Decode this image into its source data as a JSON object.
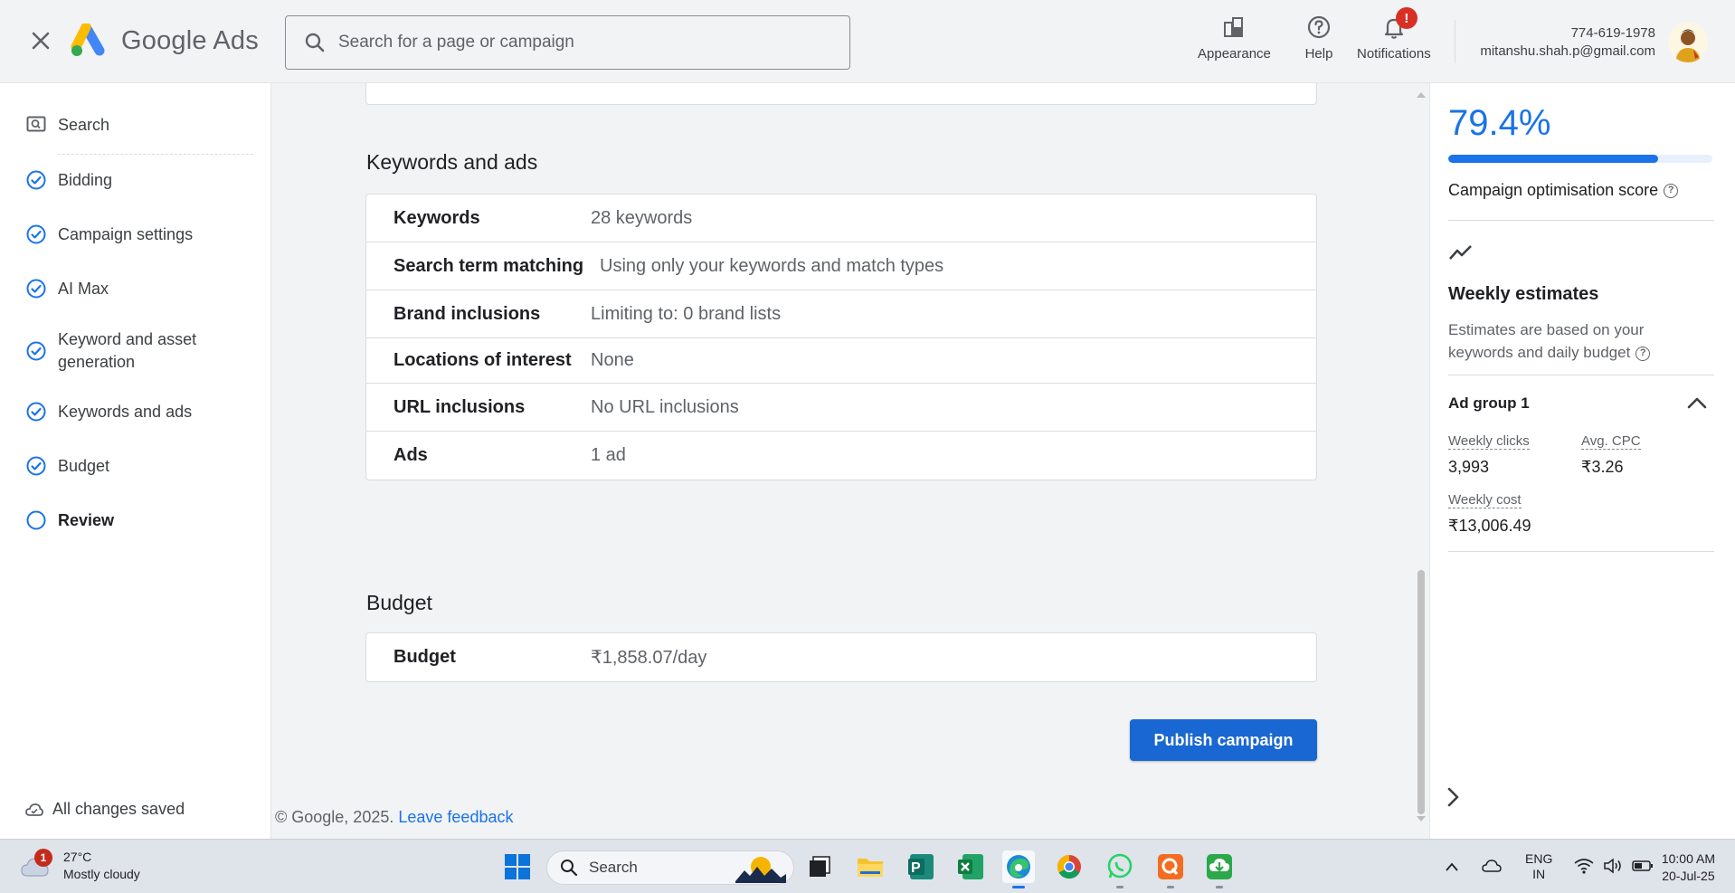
{
  "header": {
    "brand_google": "Google",
    "brand_ads": "Ads",
    "search_placeholder": "Search for a page or campaign",
    "tools": [
      {
        "label": "Appearance",
        "icon": "appearance-icon"
      },
      {
        "label": "Help",
        "icon": "help-icon"
      },
      {
        "label": "Notifications",
        "icon": "bell-icon",
        "badge": "!"
      }
    ],
    "account_phone": "774-619-1978",
    "account_email": "mitanshu.shah.p@gmail.com"
  },
  "sidebar": {
    "items": [
      {
        "label": "Search",
        "icon": "search-campaign-icon",
        "state": "header"
      },
      {
        "label": "Bidding",
        "icon": "check-circle-icon",
        "state": "done"
      },
      {
        "label": "Campaign settings",
        "icon": "check-circle-icon",
        "state": "done"
      },
      {
        "label": "AI Max",
        "icon": "check-circle-icon",
        "state": "done"
      },
      {
        "label": "Keyword and asset generation",
        "icon": "check-circle-icon",
        "state": "done"
      },
      {
        "label": "Keywords and ads",
        "icon": "check-circle-icon",
        "state": "done"
      },
      {
        "label": "Budget",
        "icon": "check-circle-icon",
        "state": "done"
      },
      {
        "label": "Review",
        "icon": "circle-icon",
        "state": "active"
      }
    ],
    "saved_text": "All changes saved"
  },
  "main": {
    "keywords_section": {
      "title": "Keywords and ads",
      "rows": [
        {
          "label": "Keywords",
          "value": "28 keywords"
        },
        {
          "label": "Search term matching",
          "value": "Using only your keywords and match types"
        },
        {
          "label": "Brand inclusions",
          "value": "Limiting to: 0 brand lists"
        },
        {
          "label": "Locations of interest",
          "value": "None"
        },
        {
          "label": "URL inclusions",
          "value": "No URL inclusions"
        },
        {
          "label": "Ads",
          "value": "1 ad"
        }
      ]
    },
    "budget_section": {
      "title": "Budget",
      "rows": [
        {
          "label": "Budget",
          "value": "₹1,858.07/day"
        }
      ]
    },
    "publish_label": "Publish campaign",
    "footer_copyright": "© Google, 2025.",
    "footer_link": "Leave feedback"
  },
  "right_panel": {
    "score": "79.4%",
    "score_fraction": 0.794,
    "score_label": "Campaign optimisation score",
    "weekly_title": "Weekly estimates",
    "weekly_desc": "Estimates are based on your keywords and daily budget",
    "ad_group": "Ad group 1",
    "metrics": {
      "weekly_clicks_label": "Weekly clicks",
      "weekly_clicks": "3,993",
      "avg_cpc_label": "Avg. CPC",
      "avg_cpc": "₹3.26",
      "weekly_cost_label": "Weekly cost",
      "weekly_cost": "₹13,006.49"
    }
  },
  "taskbar": {
    "weather_badge": "1",
    "temperature": "27°C",
    "condition": "Mostly cloudy",
    "search_label": "Search",
    "language_top": "ENG",
    "language_bottom": "IN",
    "time": "10:00 AM",
    "date": "20-Jul-25"
  },
  "colors": {
    "accent": "#1a73e8",
    "button": "#1967d2",
    "background": "#f1f3f4",
    "badge": "#d93025"
  }
}
